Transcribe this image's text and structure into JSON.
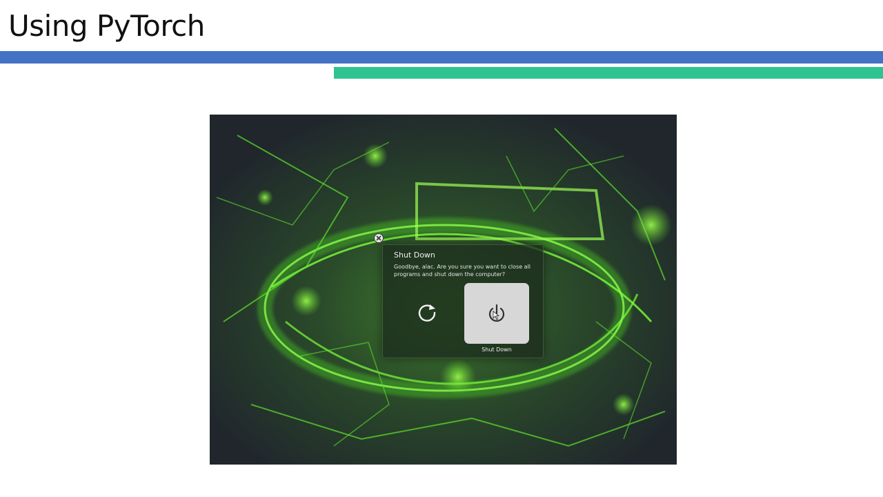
{
  "slide": {
    "title": "Using PyTorch",
    "accent_blue": "#4472c4",
    "accent_green": "#2ec391"
  },
  "photo": {
    "dialog": {
      "title": "Shut Down",
      "message": "Goodbye, alac. Are you sure you want to close all programs and shut down the computer?",
      "restart_icon": "restart-icon",
      "power_icon": "power-icon",
      "shutdown_label": "Shut Down",
      "close_icon": "close-icon"
    }
  }
}
